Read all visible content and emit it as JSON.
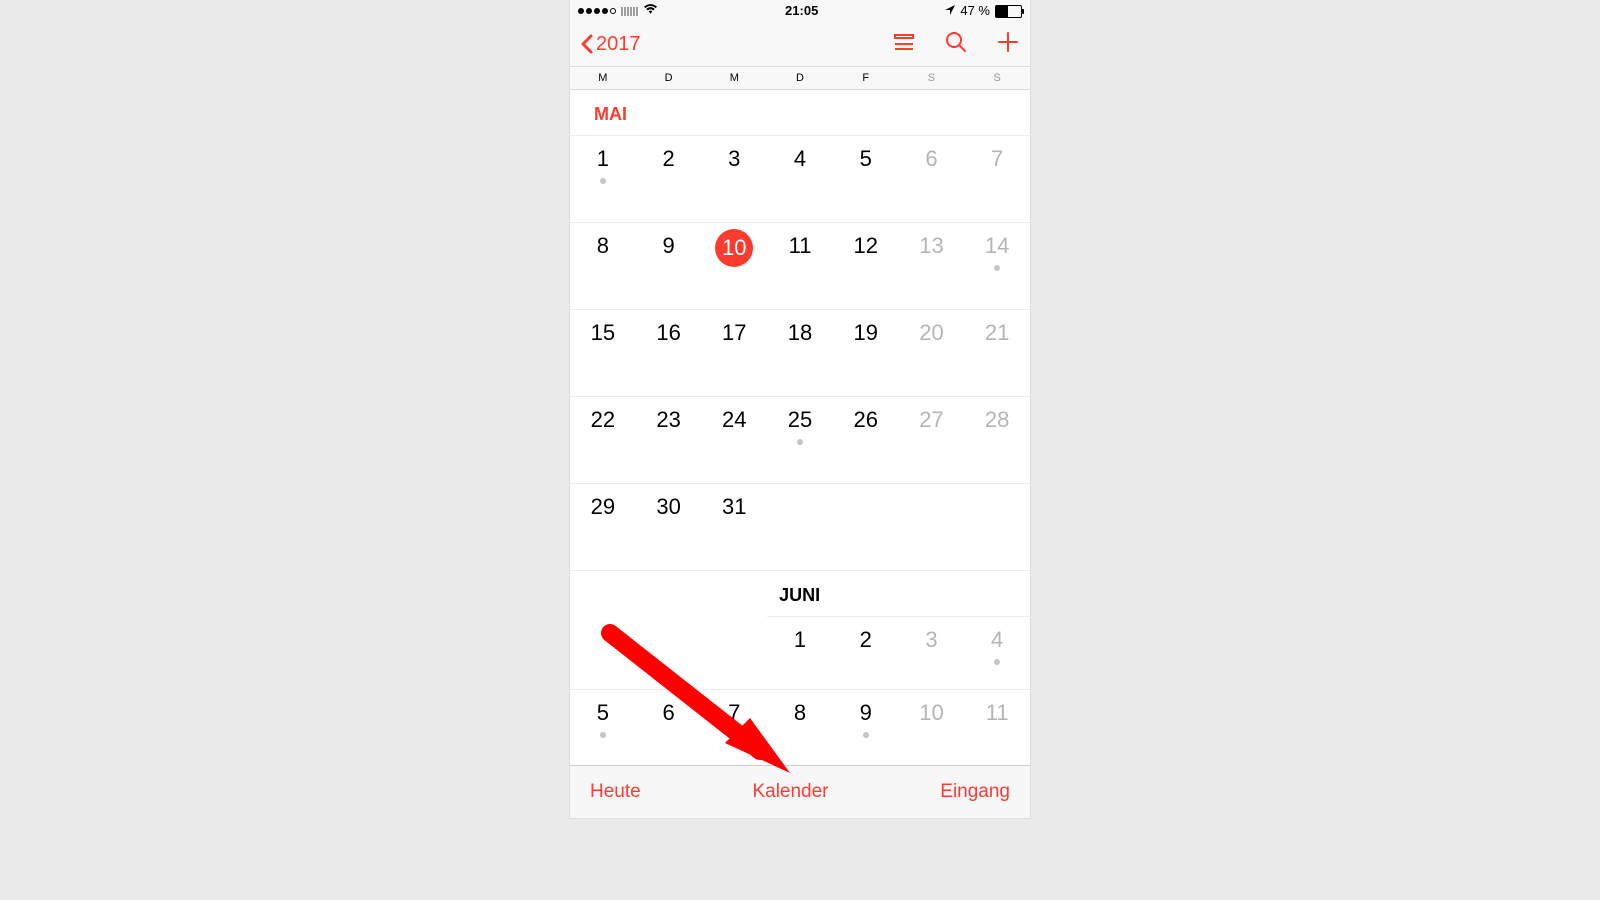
{
  "status": {
    "time": "21:05",
    "battery": "47 %"
  },
  "nav": {
    "back": "2017"
  },
  "weekdays": [
    "M",
    "D",
    "M",
    "D",
    "F",
    "S",
    "S"
  ],
  "months": {
    "may": {
      "label": "MAI",
      "rows": [
        [
          {
            "n": "1",
            "dot": true
          },
          {
            "n": "2"
          },
          {
            "n": "3"
          },
          {
            "n": "4"
          },
          {
            "n": "5"
          },
          {
            "n": "6",
            "w": true
          },
          {
            "n": "7",
            "w": true
          }
        ],
        [
          {
            "n": "8"
          },
          {
            "n": "9"
          },
          {
            "n": "10",
            "today": true
          },
          {
            "n": "11"
          },
          {
            "n": "12"
          },
          {
            "n": "13",
            "w": true
          },
          {
            "n": "14",
            "w": true,
            "dot": true
          }
        ],
        [
          {
            "n": "15"
          },
          {
            "n": "16"
          },
          {
            "n": "17"
          },
          {
            "n": "18"
          },
          {
            "n": "19"
          },
          {
            "n": "20",
            "w": true
          },
          {
            "n": "21",
            "w": true
          }
        ],
        [
          {
            "n": "22"
          },
          {
            "n": "23"
          },
          {
            "n": "24"
          },
          {
            "n": "25",
            "dot": true
          },
          {
            "n": "26"
          },
          {
            "n": "27",
            "w": true
          },
          {
            "n": "28",
            "w": true
          }
        ],
        [
          {
            "n": "29"
          },
          {
            "n": "30"
          },
          {
            "n": "31"
          },
          null,
          null,
          null,
          null
        ]
      ]
    },
    "june": {
      "label": "JUNI",
      "rows": [
        [
          null,
          null,
          null,
          {
            "n": "1"
          },
          {
            "n": "2"
          },
          {
            "n": "3",
            "w": true
          },
          {
            "n": "4",
            "w": true,
            "dot": true
          }
        ],
        [
          {
            "n": "5",
            "dot": true
          },
          {
            "n": "6"
          },
          {
            "n": "7"
          },
          {
            "n": "8"
          },
          {
            "n": "9",
            "dot": true
          },
          {
            "n": "10",
            "w": true
          },
          {
            "n": "11",
            "w": true
          }
        ]
      ]
    }
  },
  "toolbar": {
    "today": "Heute",
    "calendars": "Kalender",
    "inbox": "Eingang"
  }
}
